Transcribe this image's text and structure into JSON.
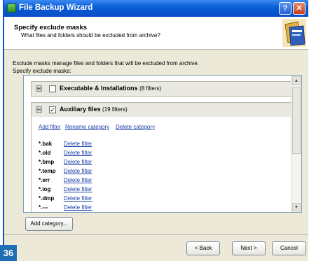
{
  "window": {
    "title": "File Backup Wizard",
    "help_glyph": "?",
    "close_glyph": "✕"
  },
  "header": {
    "title": "Specify exclude masks",
    "subtitle": "What files and folders should be excluded from archive?"
  },
  "description": {
    "line1": "Exclude masks manage files and folders that will be excluded from archive.",
    "line2": "Specify exclude masks:"
  },
  "categories": [
    {
      "name": "Executable & Installations",
      "count": "(8 filters)",
      "expander": "⊞",
      "checked": false,
      "check_glyph": ""
    },
    {
      "name": "Auxiliary files",
      "count": "(19 filters)",
      "expander": "⊟",
      "checked": true,
      "check_glyph": "✓",
      "actions": {
        "add_filter": "Add filter",
        "rename_category": "Rename category",
        "delete_category": "Delete category"
      },
      "filters": [
        {
          "mask": "*.bak",
          "action": "Delete filter"
        },
        {
          "mask": "*.old",
          "action": "Delete filter"
        },
        {
          "mask": "*.bmp",
          "action": "Delete filter"
        },
        {
          "mask": "*.temp",
          "action": "Delete filter"
        },
        {
          "mask": "*.err",
          "action": "Delete filter"
        },
        {
          "mask": "*.log",
          "action": "Delete filter"
        },
        {
          "mask": "*.dmp",
          "action": "Delete filter"
        },
        {
          "mask": "*.---",
          "action": "Delete filter"
        }
      ]
    }
  ],
  "buttons": {
    "add_category": "Add category...",
    "back": "< Back",
    "next": "Next >",
    "cancel": "Cancel"
  },
  "scroll": {
    "up": "▲",
    "down": "▼"
  },
  "badge": "36",
  "colors": {
    "titlebar": "#0a5fd8",
    "link": "#1a3fa8",
    "badge": "#1f6fb5"
  }
}
